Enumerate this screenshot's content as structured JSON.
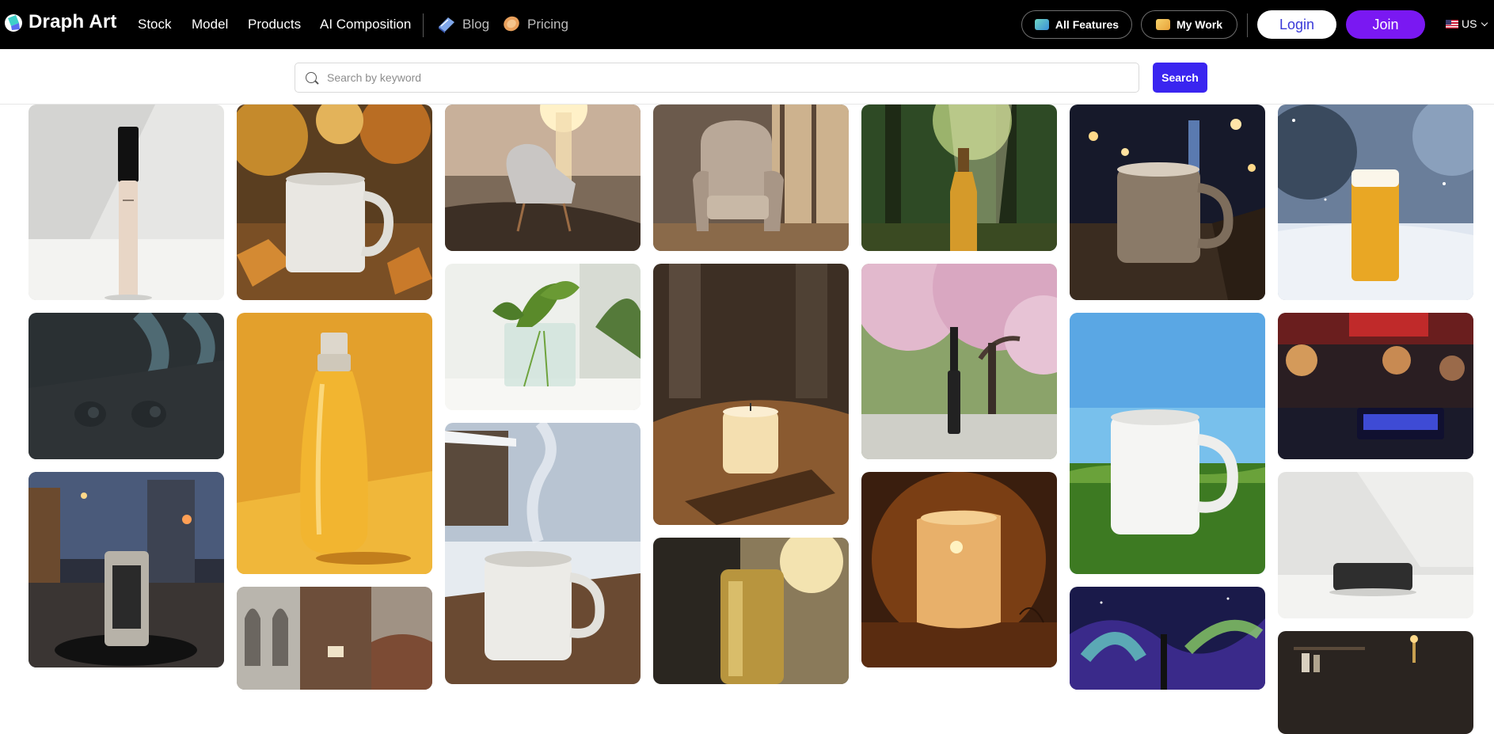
{
  "header": {
    "brand": "Draph Art",
    "nav": [
      "Stock",
      "Model",
      "Products",
      "AI Composition"
    ],
    "secondary_nav": [
      {
        "label": "Blog",
        "icon": "book-icon"
      },
      {
        "label": "Pricing",
        "icon": "tag-icon"
      }
    ],
    "all_features": "All Features",
    "my_work": "My Work",
    "login": "Login",
    "join": "Join",
    "locale": "US"
  },
  "search": {
    "placeholder": "Search by keyword",
    "value": "",
    "button": "Search"
  },
  "gallery": {
    "columns": [
      [
        "concealer tube on white table",
        "black wireless earbuds on dark table",
        "beer can on city street at night"
      ],
      [
        "white mug in autumn leaves",
        "amber bottle in golden light",
        "hotel room with ornate bed"
      ],
      [
        "armchair on rocks at sunset lake",
        "plant in glass vase",
        "steaming mug on snowy table"
      ],
      [
        "upholstered armchair by window",
        "candle on wooden table",
        "gold can in window light"
      ],
      [
        "beer bottle in sunlit forest",
        "mascara under cherry blossoms",
        "flickering candle on dark table"
      ],
      [
        "mug on wooden rail at night",
        "white mug on grass under blue sky",
        "mascara under aurora"
      ],
      [
        "beer glass in snow",
        "digital clock at night market",
        "black speaker on white surface",
        "dark shelf interior"
      ]
    ]
  },
  "colors": {
    "topbar": "#000000",
    "join": "#7a18f2",
    "login_text": "#3a3ad8",
    "search_button": "#3a25f0"
  }
}
